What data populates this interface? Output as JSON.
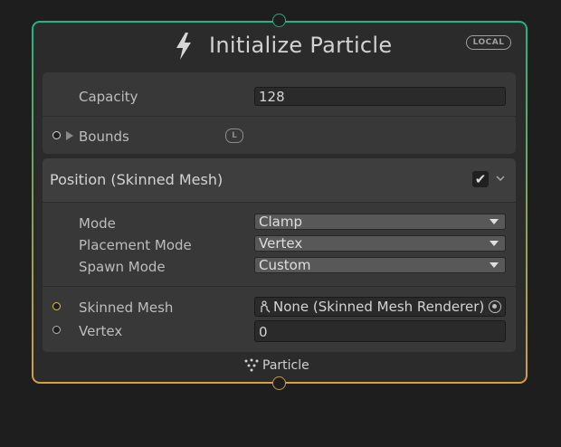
{
  "node": {
    "title": "Initialize Particle",
    "icon": "lightning-bolt-icon",
    "space_badge": "LOCAL",
    "output_label": "Particle",
    "output_icon": "particle-icon",
    "colors": {
      "input_edge": "#1fb585",
      "output_edge": "#d3a03a"
    }
  },
  "settings": {
    "capacity_label": "Capacity",
    "capacity_value": "128",
    "bounds_label": "Bounds",
    "bounds_space_badge": "L"
  },
  "block": {
    "title": "Position (Skinned Mesh)",
    "enabled": true,
    "mode_label": "Mode",
    "mode_value": "Clamp",
    "placement_label": "Placement Mode",
    "placement_value": "Vertex",
    "spawn_label": "Spawn Mode",
    "spawn_value": "Custom",
    "skinned_mesh_label": "Skinned Mesh",
    "skinned_mesh_value": "None (Skinned Mesh Renderer)",
    "vertex_label": "Vertex",
    "vertex_value": "0"
  }
}
